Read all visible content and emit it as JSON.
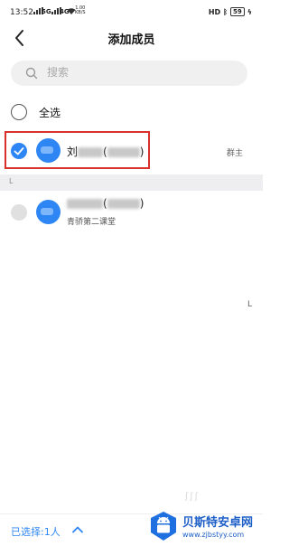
{
  "status_bar": {
    "time": "13:52",
    "signal_1": "5G",
    "signal_2": "4G",
    "net_speed_value": "1.00",
    "net_speed_unit": "KB/S",
    "hd_label": "HD",
    "battery": "59"
  },
  "nav": {
    "title": "添加成员"
  },
  "search": {
    "placeholder": "搜索"
  },
  "select_all": {
    "label": "全选",
    "checked": false
  },
  "members": [
    {
      "name_visible_prefix": "刘",
      "name_visible_suffix": ")",
      "role": "群主",
      "checked": true
    },
    {
      "name_visible_suffix": ")",
      "subtitle": "青骄第二课堂",
      "checked": false,
      "disabled": true
    }
  ],
  "section": {
    "letter": "L"
  },
  "index_bar": {
    "letter": "L"
  },
  "bottom_bar": {
    "selected_label": "已选择:1人"
  },
  "watermark": {
    "title": "贝斯特安卓网",
    "url": "www.zjbstyy.com"
  },
  "colors": {
    "accent": "#2e86f5",
    "highlight_border": "#d9302b",
    "section_bg": "#eeeef0"
  }
}
